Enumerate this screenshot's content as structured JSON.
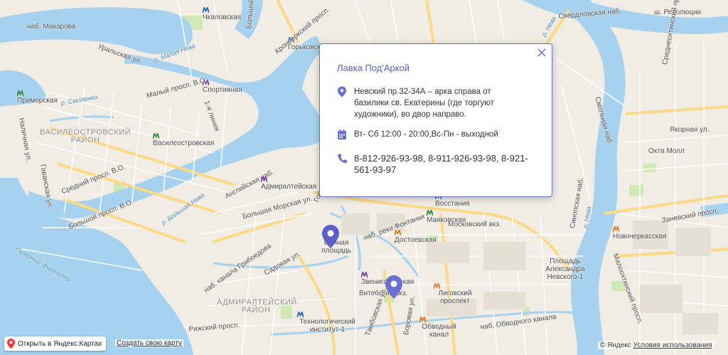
{
  "popup": {
    "title": "Лавка Под'Аркой",
    "address": "Невский пр.32-34А – арка справа от базилики св. Екатерины (где торгуют художники), во двор направо.",
    "hours": "Вт- Сб 12:00 - 20:00,Вс-Пн - выходной",
    "phones": "8-812-926-93-98, 8-911-926-93-98, 8-921-561-93-97",
    "icons": [
      "location-pin-icon",
      "calendar-icon",
      "phone-icon",
      "close-icon"
    ],
    "accent": "#5b5fc7"
  },
  "controls": {
    "open_yandex": "Открыть в Яндекс.Картах",
    "create_map": "Создать свою карту",
    "copyright": "© Яндекс",
    "terms": "Условия использования"
  },
  "labels": {
    "makarova": "наб. Макарова",
    "chkalovskaya": "Чкаловская",
    "bolshoy_prosp": "Большой просп.",
    "gorkovskaya": "Горьковская",
    "kronverksky": "Кронверкский просп.",
    "uralskaya": "Уральская ул.",
    "malaya_neva": "р. Малая Нева",
    "sportivnaya": "Спортивная",
    "primorskaya": "Приморская",
    "smolenka": "р. Смоленка",
    "maly_vo": "Малый просп. В.О.",
    "lineya": "1-я линия",
    "vasileostrovsky": "ВАСИЛЕОСТРОВСКИЙ РАЙОН",
    "vasileostrovskaya": "Василеостровская",
    "nalichnaya": "Наличная ул.",
    "gavanskaya": "Гаванская ул.",
    "sredny_vo": "Средний просп. В.О.",
    "bolshoy_vo": "Большой просп. В.О.",
    "bolshaya_neva": "р. Большая Нева",
    "angliyskaya": "Английская наб.",
    "admiralteyskaya": "Адмиралтейская",
    "bolshaya_morskaya": "Большая Морская ул.",
    "gorokhovaya": "Гороховая ул.",
    "vosstaniya": "Восстания",
    "mayakovskaya": "Маяковская",
    "moskovsky_vkz": "Московский вкз.",
    "fontanka": "наб. реки Фонтанки",
    "dostoevskaya": "Достоевская",
    "sennaya": "Сенная площадь",
    "galerny": "Галерный фарватер",
    "kanal_griboedova": "наб. канала Грибоедова",
    "sadovaya": "Садовая ул.",
    "zvenigorodskaya": "Звенигородская",
    "vitebsky": "Витебский вкз.",
    "ligovsky": "Лиговский проспект",
    "admiralteysky": "АДМИРАЛТЕЙСКИЙ РАЙОН",
    "tekhnologichesky": "Технологический институт-1",
    "rizhsky": "Рижский просп.",
    "obvodny_stn": "Обводный канал",
    "obvodny_nab": "наб. Обводного канала",
    "borovaya": "Боровая ул.",
    "tambovskaya": "Тамбовская ул.",
    "sverdlovskaya": "Свердловская наб.",
    "revolyutsii": "ш. Революции",
    "neva": "р. Нева",
    "smolnaya": "Смольная наб.",
    "sredneokhtinsky": "Среднеохтинский просп.",
    "yakornaya": "Якорная ул.",
    "okhta_moll": "Охта Молл",
    "novocherkasskaya": "Новочеркасская",
    "zanevsky": "Заневский просп.",
    "malookhtinsky": "Малоохтинский просп.",
    "sinopskaya": "Синопская наб.",
    "ploshchad_nevskogo": "Площадь Александра Невского-1"
  }
}
